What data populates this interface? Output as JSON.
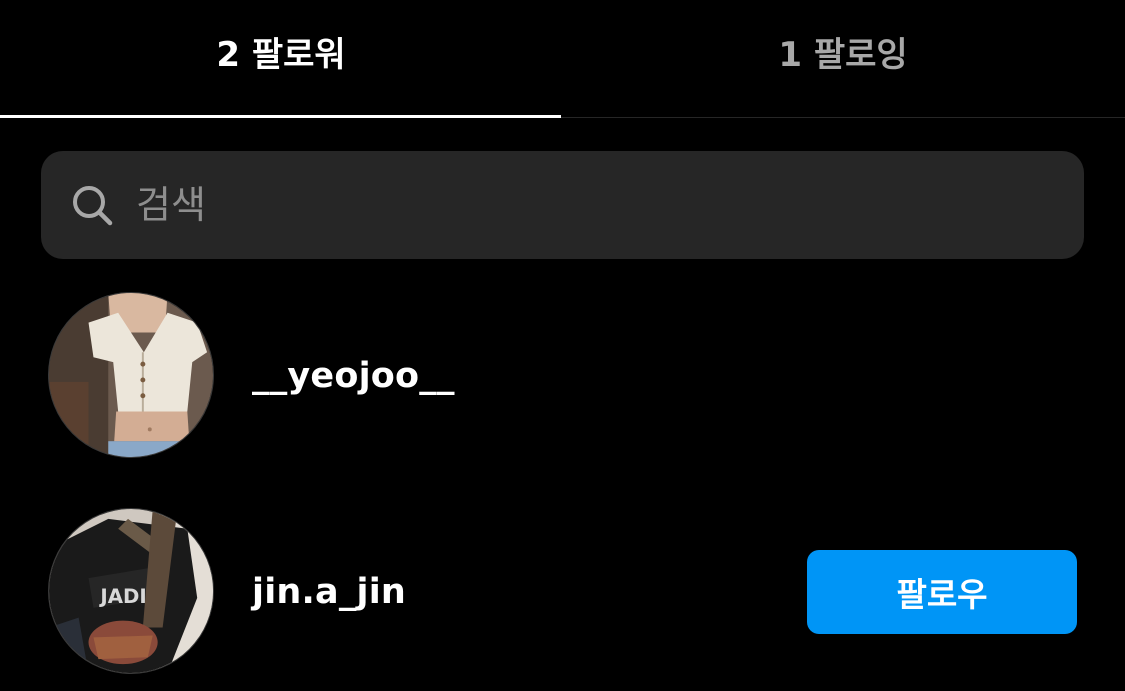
{
  "tabs": {
    "followers_label": "2 팔로워",
    "following_label": "1 팔로잉",
    "active": "followers"
  },
  "search": {
    "placeholder": "검색",
    "icon": "search-icon"
  },
  "list": [
    {
      "username": "__yeojoo__",
      "avatar": "avatar-photo",
      "button": null
    },
    {
      "username": "jin.a_jin",
      "avatar": "avatar-photo",
      "button": "팔로우"
    }
  ],
  "colors": {
    "background": "#000000",
    "search_bg": "#262626",
    "inactive_tab": "#a8a8a8",
    "follow_button": "#0095f6",
    "placeholder": "#8e8e8e"
  }
}
